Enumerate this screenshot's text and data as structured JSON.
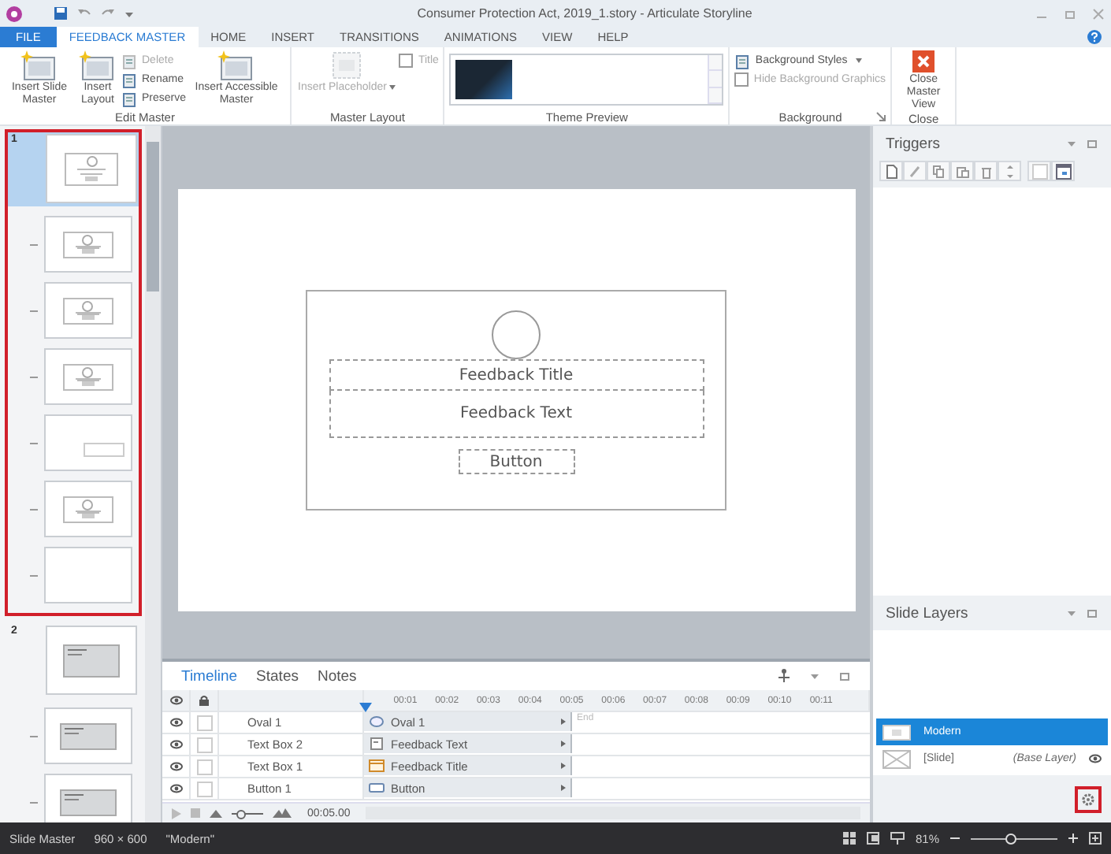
{
  "window": {
    "title": "Consumer Protection Act, 2019_1.story - Articulate Storyline"
  },
  "ribbon_tabs": [
    {
      "label": "FILE",
      "kind": "file",
      "selected": false
    },
    {
      "label": "FEEDBACK MASTER",
      "kind": "tab",
      "selected": true
    },
    {
      "label": "HOME",
      "kind": "tab",
      "selected": false
    },
    {
      "label": "INSERT",
      "kind": "tab",
      "selected": false
    },
    {
      "label": "TRANSITIONS",
      "kind": "tab",
      "selected": false
    },
    {
      "label": "ANIMATIONS",
      "kind": "tab",
      "selected": false
    },
    {
      "label": "VIEW",
      "kind": "tab",
      "selected": false
    },
    {
      "label": "HELP",
      "kind": "tab",
      "selected": false
    }
  ],
  "ribbon_groups": [
    {
      "label": "Edit Master",
      "launcher": false,
      "items": [
        {
          "kind": "large",
          "label": "Insert Slide Master",
          "disabled": false
        },
        {
          "kind": "large",
          "label": "Insert Layout",
          "disabled": false
        },
        {
          "kind": "stack",
          "items": [
            {
              "kind": "button",
              "label": "Delete",
              "disabled": true
            },
            {
              "kind": "button",
              "label": "Rename",
              "disabled": false
            },
            {
              "kind": "button",
              "label": "Preserve",
              "disabled": false
            }
          ]
        },
        {
          "kind": "large",
          "label": "Insert Accessible Master",
          "disabled": false
        }
      ]
    },
    {
      "label": "Master Layout",
      "launcher": false,
      "items": [
        {
          "kind": "large",
          "label": "Insert Placeholder",
          "disabled": true,
          "dropdown": true
        },
        {
          "kind": "stack",
          "items": [
            {
              "kind": "check",
              "label": "Title",
              "checked": false,
              "disabled": true
            }
          ]
        }
      ]
    },
    {
      "label": "Theme Preview",
      "launcher": false,
      "items": [
        {
          "kind": "gallery"
        }
      ]
    },
    {
      "label": "Background",
      "launcher": true,
      "items": [
        {
          "kind": "stack",
          "items": [
            {
              "kind": "button",
              "label": "Background Styles",
              "disabled": false,
              "dropdown": true
            },
            {
              "kind": "check",
              "label": "Hide Background Graphics",
              "checked": false,
              "disabled": true
            }
          ]
        }
      ]
    },
    {
      "label": "Close",
      "launcher": false,
      "items": [
        {
          "kind": "close",
          "label": "Close Master View",
          "disabled": false
        }
      ]
    }
  ],
  "slide_masters": [
    {
      "number": "1",
      "selected": true,
      "outlined": true,
      "kind": "feedback",
      "layouts": [
        {
          "kind": "feedback"
        },
        {
          "kind": "feedback"
        },
        {
          "kind": "feedback"
        },
        {
          "kind": "button"
        },
        {
          "kind": "feedback"
        },
        {
          "kind": "blank"
        }
      ]
    },
    {
      "number": "2",
      "selected": false,
      "outlined": false,
      "kind": "banner",
      "layouts": [
        {
          "kind": "banner"
        },
        {
          "kind": "banner"
        }
      ]
    }
  ],
  "slide": {
    "title": "Feedback Title",
    "text": "Feedback Text",
    "button": "Button"
  },
  "timeline": {
    "tabs": [
      {
        "label": "Timeline",
        "selected": true
      },
      {
        "label": "States",
        "selected": false
      },
      {
        "label": "Notes",
        "selected": false
      }
    ],
    "ticks": [
      "00:01",
      "00:02",
      "00:03",
      "00:04",
      "00:05",
      "00:06",
      "00:07",
      "00:08",
      "00:09",
      "00:10",
      "00:11"
    ],
    "end_label": "End",
    "rows": [
      {
        "name": "Oval 1",
        "bar": "Oval 1",
        "kind": "oval",
        "visible": true,
        "locked": false
      },
      {
        "name": "Text Box 2",
        "bar": "Feedback Text",
        "kind": "text",
        "visible": true,
        "locked": false
      },
      {
        "name": "Text Box 1",
        "bar": "Feedback Title",
        "kind": "title",
        "visible": true,
        "locked": false
      },
      {
        "name": "Button 1",
        "bar": "Button",
        "kind": "button",
        "visible": true,
        "locked": false
      }
    ],
    "duration": "00:05.00",
    "zoom": {
      "level": 0.3
    }
  },
  "triggers": {
    "title": "Triggers"
  },
  "slide_layers": {
    "title": "Slide Layers",
    "layers": [
      {
        "name": "Modern",
        "selected": true
      },
      {
        "name": "[Slide]",
        "note": "(Base Layer)",
        "selected": false
      }
    ]
  },
  "status_bar": {
    "items": [
      "Slide Master",
      "960 × 600",
      "\"Modern\""
    ],
    "zoom": {
      "reading": "81%",
      "level": 0.45
    }
  }
}
